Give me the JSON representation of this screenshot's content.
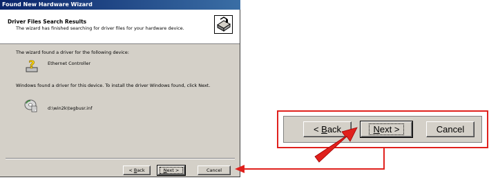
{
  "dialog": {
    "title": "Found New Hardware Wizard",
    "header_title": "Driver Files Search Results",
    "header_subtitle": "The wizard has finished searching for driver files for your hardware device.",
    "line_found": "The wizard found a driver for the following device:",
    "device_name": "Ethernet Controller",
    "line_install": "Windows found a driver for this device. To install the driver Windows found, click Next.",
    "file_path": "d:\\win2k\\tegbusr.inf",
    "buttons": {
      "back_prefix": "< ",
      "back_hotkey": "B",
      "back_rest": "ack",
      "next_hotkey": "N",
      "next_rest": "ext >",
      "cancel": "Cancel"
    }
  },
  "callout": {
    "back_prefix": "< ",
    "back_hotkey": "B",
    "back_rest": "ack",
    "next_hotkey": "N",
    "next_rest": "ext >",
    "cancel": "Cancel"
  },
  "colors": {
    "title_bar_start": "#0a246a",
    "title_bar_end": "#3a6ea5",
    "dialog_face": "#d4d0c8",
    "highlight": "#e0201c"
  },
  "icons": {
    "wizard": "hardware-wizard-icon",
    "device": "unknown-device-icon",
    "driver_file": "driver-disk-icon",
    "pointer": "red-arrow-icon"
  }
}
